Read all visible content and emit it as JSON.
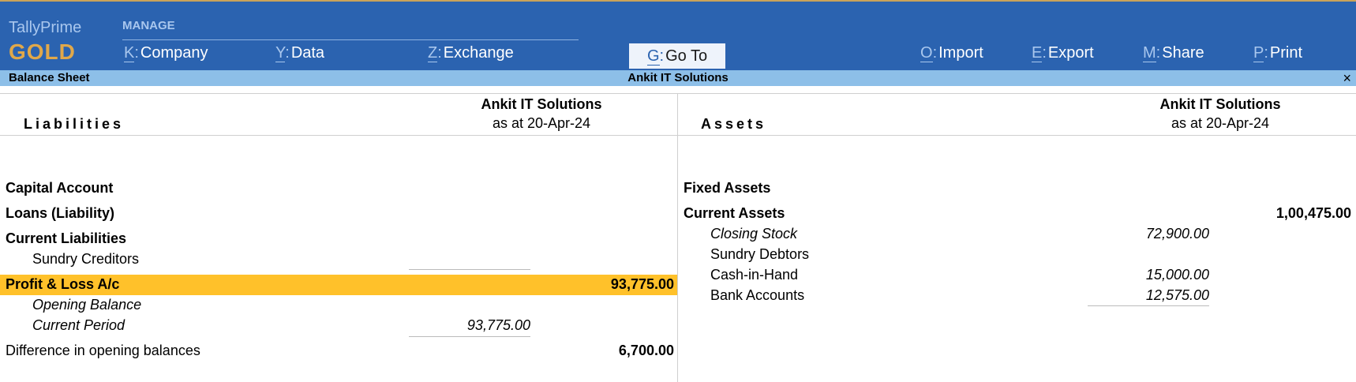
{
  "brand": {
    "name": "TallyPrime",
    "edition": "GOLD"
  },
  "menu": {
    "section": "MANAGE",
    "items": [
      {
        "key": "K",
        "label": "Company"
      },
      {
        "key": "Y",
        "label": "Data"
      },
      {
        "key": "Z",
        "label": "Exchange"
      },
      {
        "key": "G",
        "label": "Go To"
      },
      {
        "key": "O",
        "label": "Import"
      },
      {
        "key": "E",
        "label": "Export"
      },
      {
        "key": "M",
        "label": "Share"
      },
      {
        "key": "P",
        "label": "Print"
      }
    ]
  },
  "titlebar": {
    "report": "Balance Sheet",
    "company": "Ankit IT Solutions",
    "close_icon": "×"
  },
  "liabilities": {
    "title": "Liabilities",
    "company": "Ankit IT Solutions",
    "as_at": "as at 20-Apr-24",
    "rows": [
      {
        "label": "Capital Account",
        "amount": ""
      },
      {
        "label": "Loans (Liability)",
        "amount": ""
      },
      {
        "label": "Current Liabilities",
        "amount": ""
      },
      {
        "label": "Sundry Creditors",
        "amount": ""
      },
      {
        "label": "Profit & Loss A/c",
        "amount": "93,775.00"
      },
      {
        "label": "Opening Balance",
        "amount": ""
      },
      {
        "label": "Current Period",
        "amount": "93,775.00"
      },
      {
        "label": "Difference in opening balances",
        "amount": "6,700.00"
      }
    ]
  },
  "assets": {
    "title": "Assets",
    "company": "Ankit IT Solutions",
    "as_at": "as at 20-Apr-24",
    "rows": [
      {
        "label": "Fixed Assets",
        "amount": ""
      },
      {
        "label": "Current Assets",
        "amount": "1,00,475.00"
      },
      {
        "label": "Closing Stock",
        "amount": "72,900.00"
      },
      {
        "label": "Sundry Debtors",
        "amount": ""
      },
      {
        "label": "Cash-in-Hand",
        "amount": "15,000.00"
      },
      {
        "label": "Bank Accounts",
        "amount": "12,575.00"
      }
    ]
  },
  "colors": {
    "header_bg": "#2b63b0",
    "titlebar_bg": "#8dbfe8",
    "highlight": "#ffc12a",
    "edition": "#e0a84a"
  }
}
